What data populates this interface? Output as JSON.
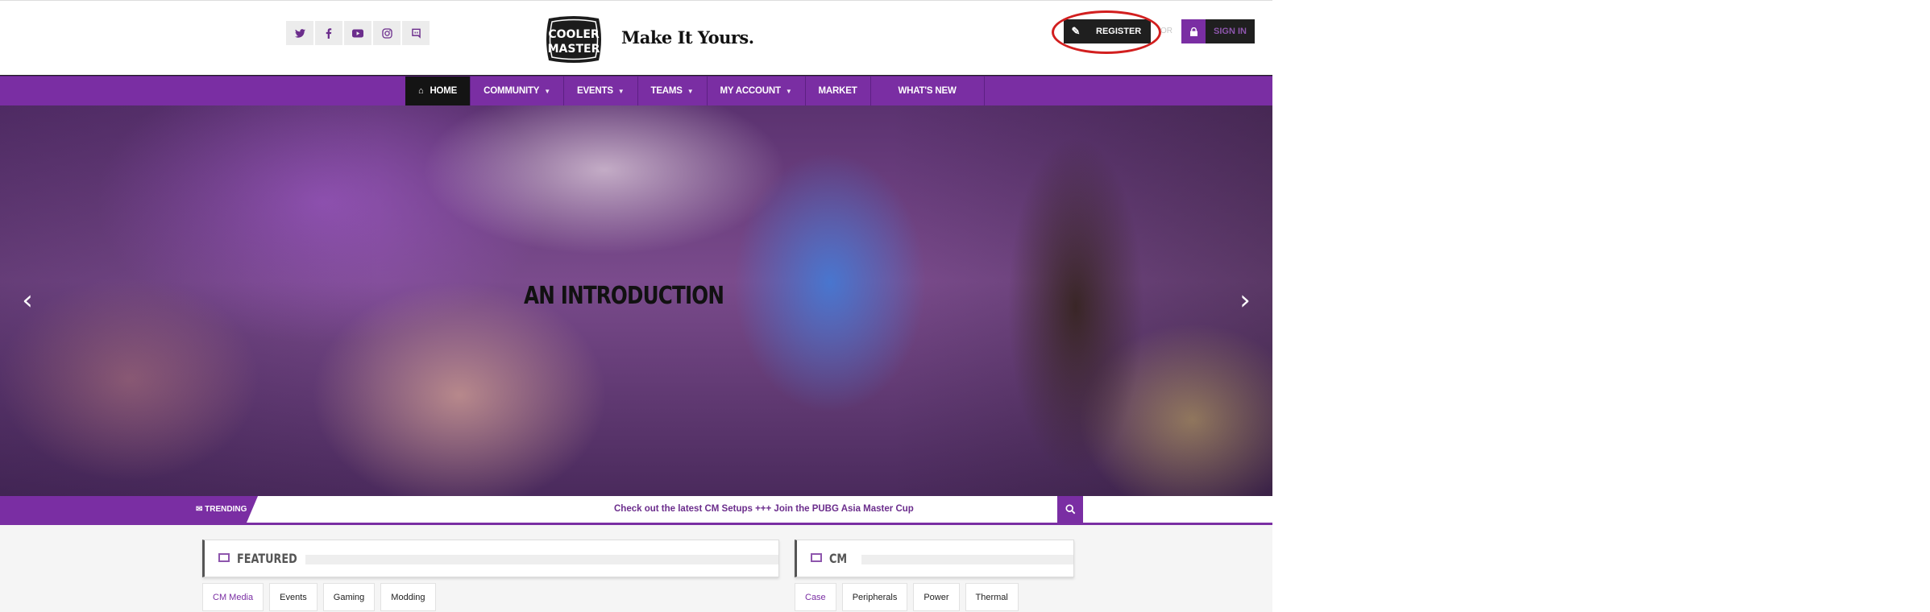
{
  "header": {
    "social_icons": [
      "twitter-icon",
      "facebook-icon",
      "youtube-icon",
      "instagram-icon",
      "discord-icon"
    ],
    "logo_text_top": "COOLER",
    "logo_text_bottom": "MASTER",
    "tagline": "Make It Yours.",
    "register_label": "REGISTER",
    "or_text": "OR",
    "signin_label": "SIGN IN"
  },
  "nav": {
    "items": [
      {
        "label": "HOME",
        "active": true
      },
      {
        "label": "COMMUNITY",
        "dropdown": true
      },
      {
        "label": "EVENTS",
        "dropdown": true
      },
      {
        "label": "TEAMS",
        "dropdown": true
      },
      {
        "label": "MY ACCOUNT",
        "dropdown": true
      },
      {
        "label": "MARKET"
      },
      {
        "label": "WHAT'S NEW"
      }
    ]
  },
  "hero": {
    "title": "AN INTRODUCTION"
  },
  "trending": {
    "label": "TRENDING",
    "ticker": "Check out the latest CM Setups +++ Join the PUBG Asia Master Cup"
  },
  "featured": {
    "title": "FEATURED",
    "tabs": [
      "CM Media",
      "Events",
      "Gaming",
      "Modding"
    ]
  },
  "cm": {
    "title": "CM",
    "tabs": [
      "Case",
      "Peripherals",
      "Power",
      "Thermal"
    ]
  },
  "colors": {
    "brand_purple": "#7a2ea3",
    "dark": "#1f1f1f",
    "highlight_ring": "#d21f1f"
  }
}
